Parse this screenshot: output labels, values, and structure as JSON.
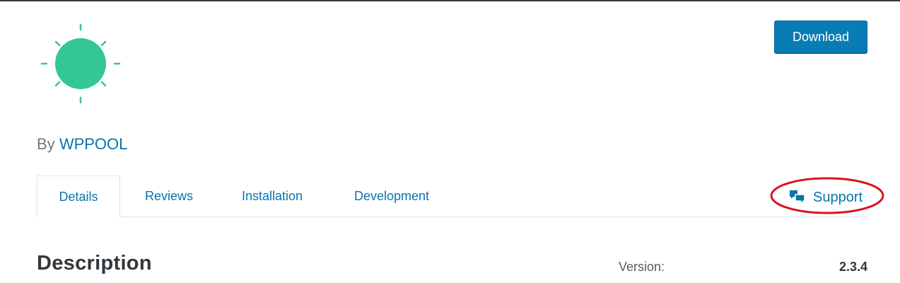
{
  "plugin": {
    "icon": "sun-icon",
    "icon_color": "#33c794"
  },
  "header": {
    "download_label": "Download"
  },
  "byline": {
    "prefix": "By",
    "author": "WPPOOL"
  },
  "tabs": [
    {
      "label": "Details",
      "active": true
    },
    {
      "label": "Reviews",
      "active": false
    },
    {
      "label": "Installation",
      "active": false
    },
    {
      "label": "Development",
      "active": false
    }
  ],
  "support": {
    "label": "Support",
    "icon": "speech-bubbles-icon",
    "highlight_color": "#d9141f"
  },
  "main": {
    "description_title": "Description"
  },
  "meta": {
    "version_label": "Version:",
    "version_value": "2.3.4"
  },
  "colors": {
    "link": "#0a73aa",
    "button": "#0a7cb5"
  }
}
